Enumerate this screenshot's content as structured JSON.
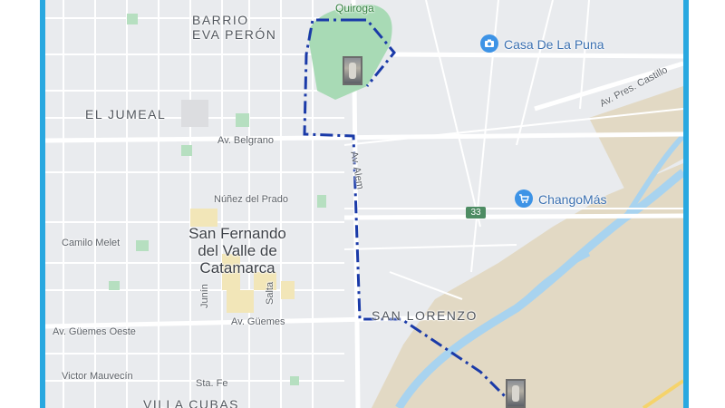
{
  "map": {
    "areas": {
      "barrio_line1": "BARRIO",
      "barrio_line2": "EVA PERÓN",
      "el_jumeal": "EL JUMEAL",
      "san_lorenzo": "SAN LORENZO",
      "villa_cubas": "VILLA CUBAS"
    },
    "city": {
      "line1": "San Fernando",
      "line2": "del Valle de",
      "line3": "Catamarca"
    },
    "roads": {
      "belgrano": "Av. Belgrano",
      "nunez": "Núñez del Prado",
      "camilo": "Camilo Melet",
      "guemes_oeste": "Av. Güemes Oeste",
      "guemes": "Av. Güemes",
      "victor": "Victor Mauvecín",
      "santa_fe": "Sta. Fe",
      "junin": "Junín",
      "salta": "Salta",
      "alem": "Av. Alem",
      "pres_castillo": "Av. Pres. Castillo"
    },
    "park_label": "Quiroga",
    "pois": [
      {
        "label": "Casa De La Puna",
        "icon": "camera-icon"
      },
      {
        "label": "ChangoMás",
        "icon": "shopping-cart-icon"
      }
    ],
    "route_shield": "33",
    "colors": {
      "frame": "#29a8e0",
      "route": "#1a3aa8",
      "park": "#a8dab5",
      "river": "#a8d3ef",
      "sand": "#e2d9c4",
      "poi": "#3d93e6"
    }
  }
}
